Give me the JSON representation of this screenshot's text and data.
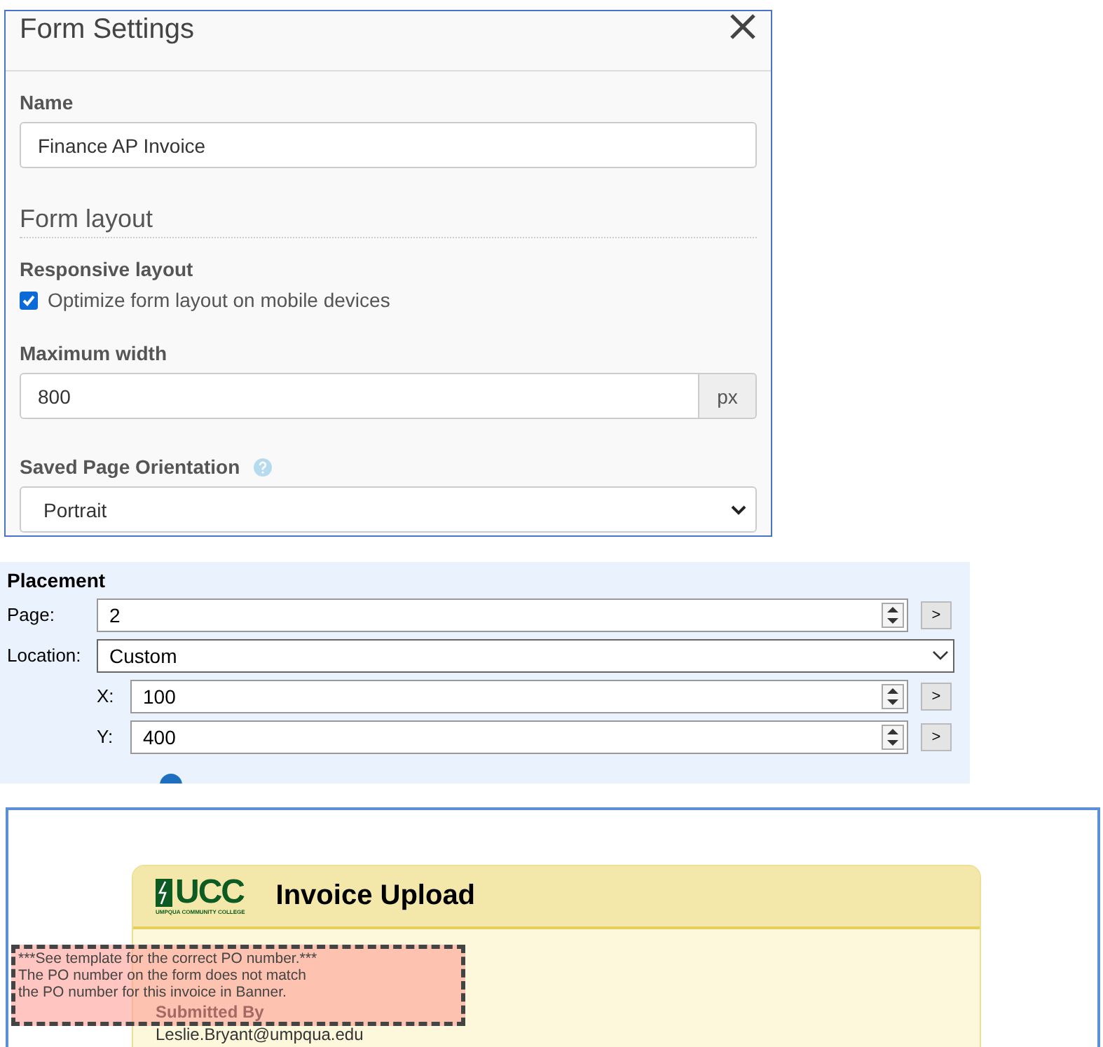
{
  "form_settings": {
    "title": "Form Settings",
    "name_label": "Name",
    "name_value": "Finance AP Invoice",
    "section_title": "Form layout",
    "responsive_label": "Responsive layout",
    "optimize_checkbox": {
      "label": "Optimize form layout on mobile devices",
      "checked": true
    },
    "max_width_label": "Maximum width",
    "max_width_value": "800",
    "max_width_unit": "px",
    "orientation_label": "Saved Page Orientation",
    "orientation_value": "Portrait"
  },
  "placement": {
    "title": "Placement",
    "fields": [
      {
        "kind": "spin",
        "label": "Page:",
        "value": "2",
        "button": ">"
      },
      {
        "kind": "select",
        "label": "Location:",
        "value": "Custom"
      },
      {
        "kind": "offset",
        "label": "X:",
        "value": "100",
        "button": ">"
      },
      {
        "kind": "offset",
        "label": "Y:",
        "value": "400",
        "button": ">"
      }
    ]
  },
  "invoice_preview": {
    "logo_text": "UCC",
    "logo_subtitle": "UMPQUA COMMUNITY COLLEGE",
    "title": "Invoice Upload",
    "submitted_label": "Submitted By",
    "submitted_value": "Leslie.Bryant@umpqua.edu",
    "note": "***See template for the correct PO number.***\nThe PO number on the form does not match\nthe PO number for this invoice in Banner."
  }
}
